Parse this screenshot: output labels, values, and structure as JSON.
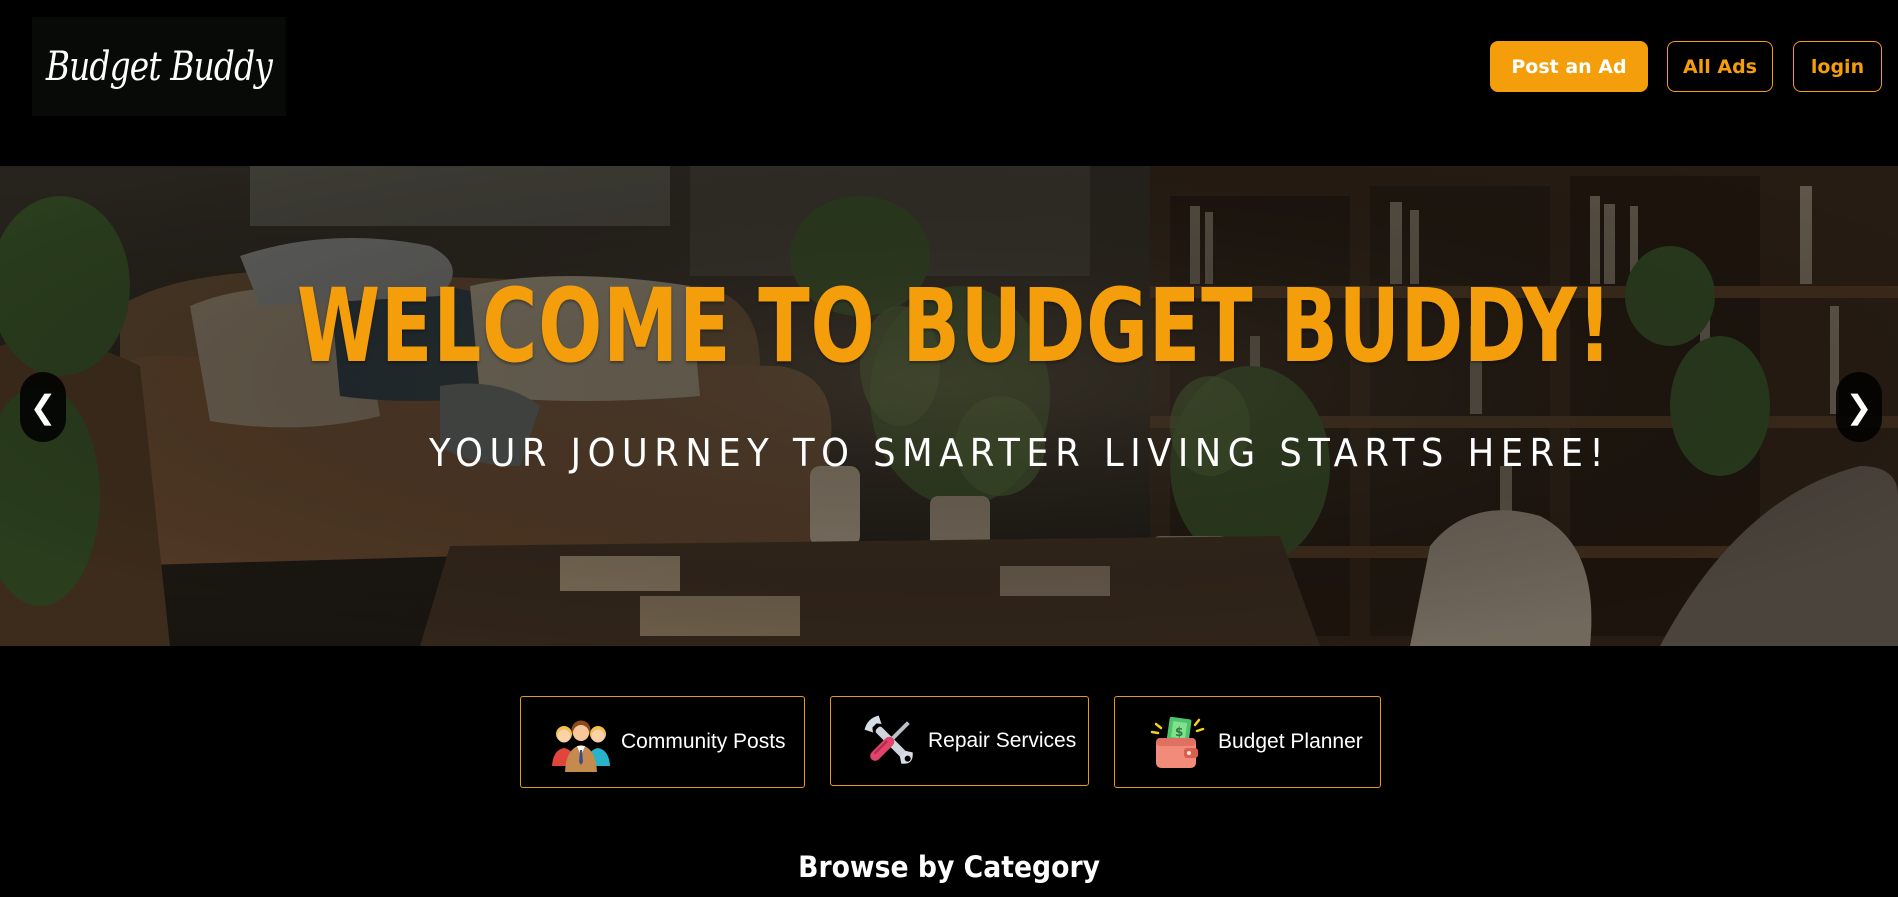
{
  "header": {
    "logo_text": "Budget Buddy",
    "nav": {
      "post_ad": "Post an Ad",
      "all_ads": "All Ads",
      "login": "login"
    }
  },
  "hero": {
    "title": "WELCOME TO BUDGET BUDDY!",
    "subtitle": "YOUR JOURNEY TO SMARTER LIVING STARTS HERE!",
    "prev_arrow": "❮",
    "next_arrow": "❯"
  },
  "quick_links": [
    {
      "label": "Community Posts",
      "icon": "community-people-icon"
    },
    {
      "label": "Repair Services",
      "icon": "wrench-screwdriver-icon"
    },
    {
      "label": "Budget Planner",
      "icon": "wallet-money-icon"
    }
  ],
  "browse": {
    "title": "Browse by Category"
  },
  "colors": {
    "accent": "#f59e0b",
    "background": "#000000",
    "text": "#ffffff"
  }
}
